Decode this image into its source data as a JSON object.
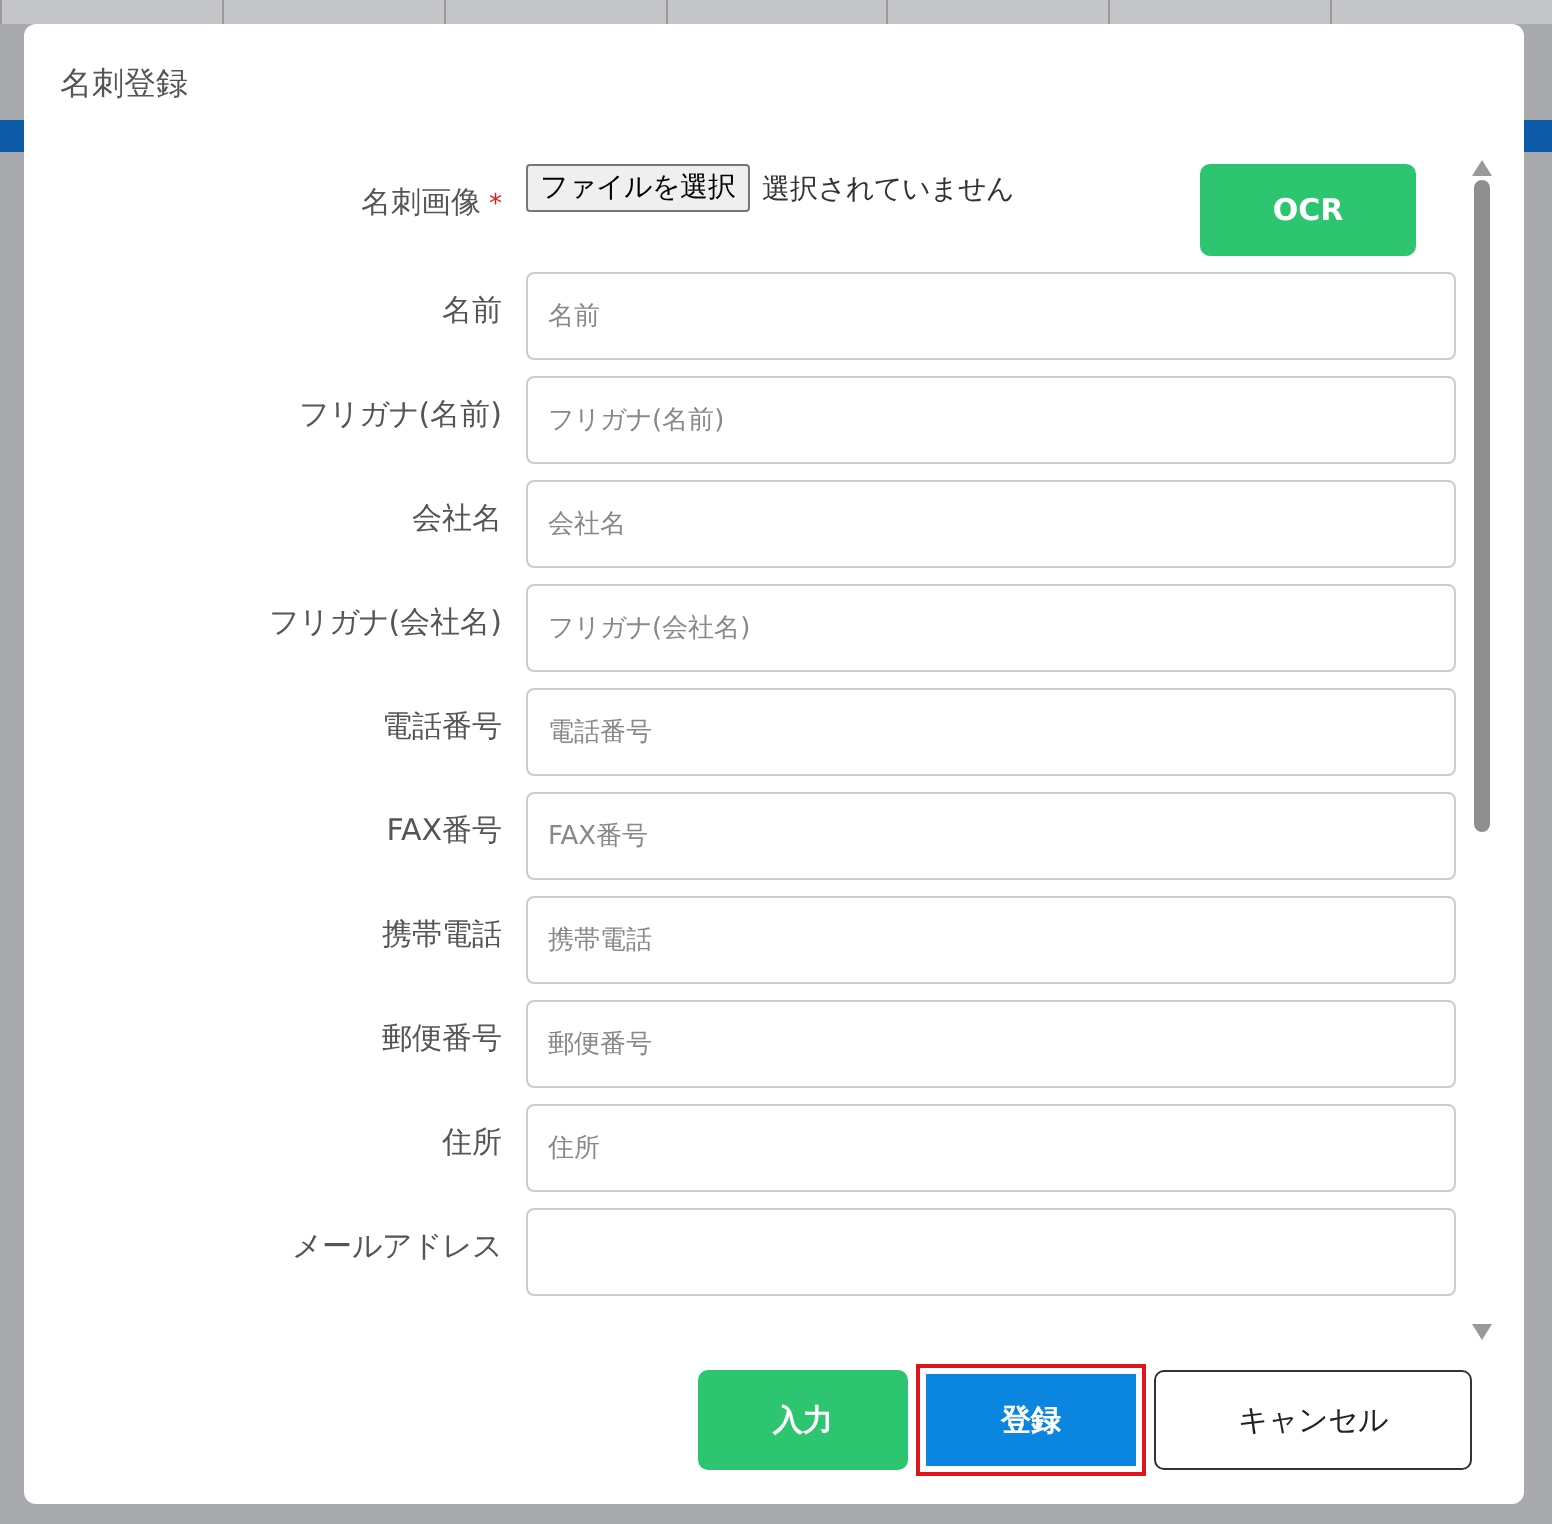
{
  "dialog": {
    "title": "名刺登録"
  },
  "fields": [
    {
      "kind": "file",
      "label": "名刺画像",
      "required_mark": "*",
      "button_label": "ファイルを選択",
      "status": "選択されていません",
      "action": "OCR"
    },
    {
      "kind": "text",
      "label": "名前",
      "placeholder": "名前"
    },
    {
      "kind": "text",
      "label": "フリガナ(名前)",
      "placeholder": "フリガナ(名前)"
    },
    {
      "kind": "text",
      "label": "会社名",
      "placeholder": "会社名"
    },
    {
      "kind": "text",
      "label": "フリガナ(会社名)",
      "placeholder": "フリガナ(会社名)"
    },
    {
      "kind": "text",
      "label": "電話番号",
      "placeholder": "電話番号"
    },
    {
      "kind": "text",
      "label": "FAX番号",
      "placeholder": "FAX番号"
    },
    {
      "kind": "text",
      "label": "携帯電話",
      "placeholder": "携帯電話"
    },
    {
      "kind": "text",
      "label": "郵便番号",
      "placeholder": "郵便番号"
    },
    {
      "kind": "text",
      "label": "住所",
      "placeholder": "住所"
    },
    {
      "kind": "text",
      "label": "メールアドレス"
    }
  ],
  "buttons": [
    {
      "kind": "success",
      "label": "入力",
      "focused": false
    },
    {
      "kind": "primary",
      "label": "登録",
      "focused": true
    },
    {
      "kind": "default",
      "label": "キャンセル",
      "focused": false
    }
  ]
}
